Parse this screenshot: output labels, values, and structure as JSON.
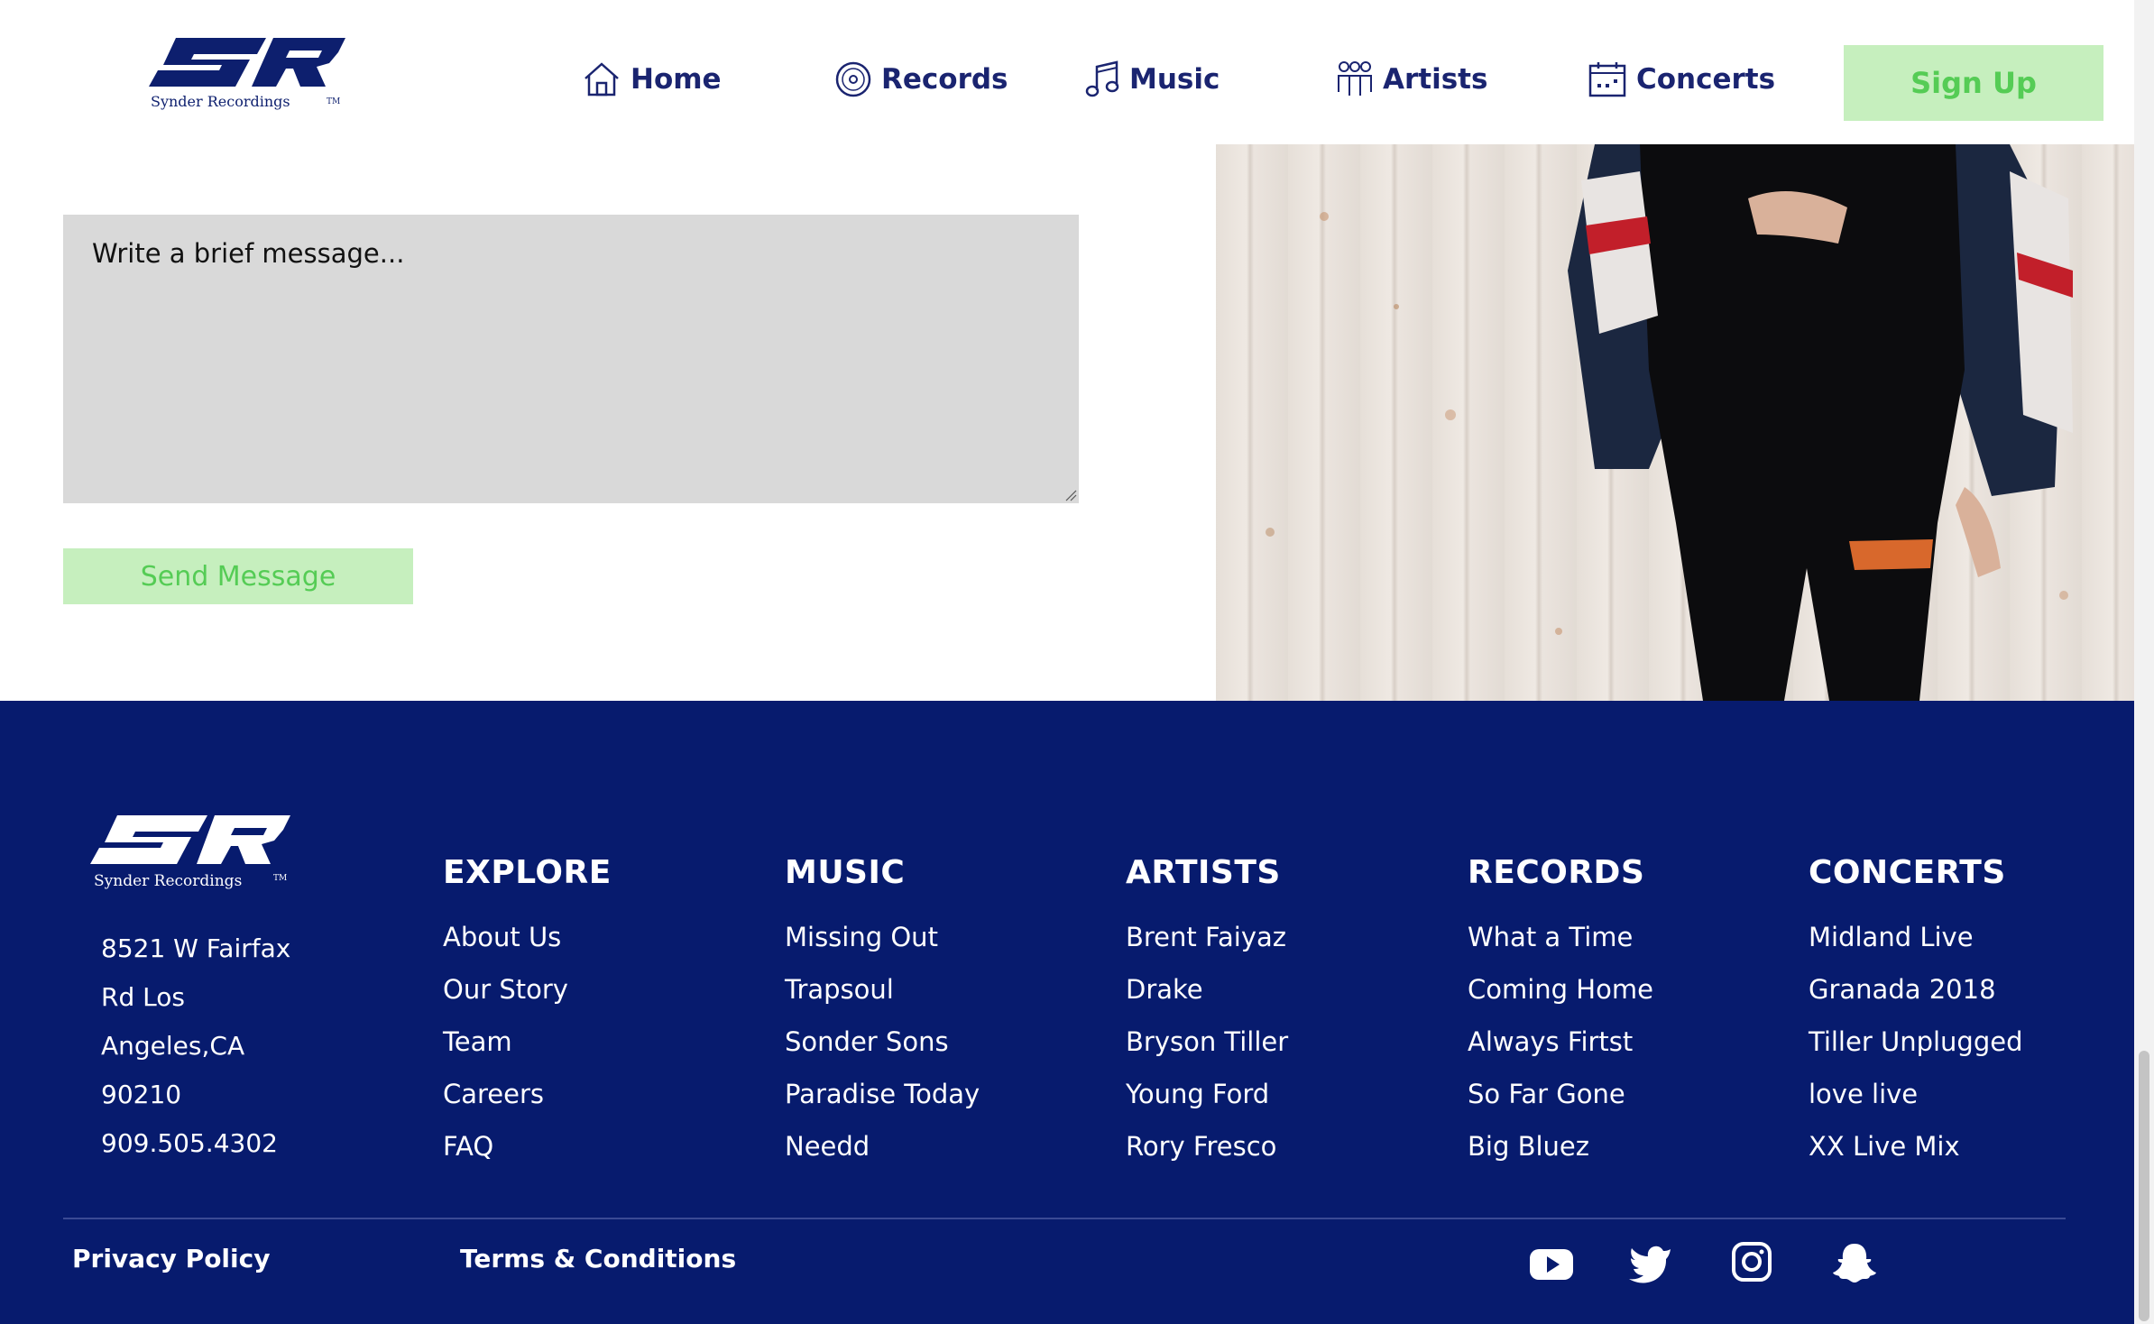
{
  "brand": {
    "logo_text": "SR",
    "tagline": "Synder   Recordings",
    "footer_tagline": "Synder Recordings",
    "tm": "TM"
  },
  "nav": {
    "items": [
      {
        "label": "Home",
        "icon": "home-icon"
      },
      {
        "label": "Records",
        "icon": "record-disc-icon"
      },
      {
        "label": "Music",
        "icon": "music-note-icon"
      },
      {
        "label": "Artists",
        "icon": "people-icon"
      },
      {
        "label": "Concerts",
        "icon": "calendar-icon"
      }
    ],
    "signup_label": "Sign Up"
  },
  "form": {
    "message_placeholder": "Write a brief message...",
    "send_label": "Send Message"
  },
  "footer": {
    "address": [
      "8521 W Fairfax",
      "Rd Los",
      "Angeles,CA",
      "90210",
      "909.505.4302"
    ],
    "columns": [
      {
        "heading": "EXPLORE",
        "links": [
          "About Us",
          "Our Story",
          "Team",
          "Careers",
          "FAQ"
        ]
      },
      {
        "heading": "MUSIC",
        "links": [
          "Missing Out",
          "Trapsoul",
          "Sonder Sons",
          "Paradise Today",
          "Needd"
        ]
      },
      {
        "heading": "ARTISTS",
        "links": [
          "Brent Faiyaz",
          "Drake",
          "Bryson Tiller",
          "Young Ford",
          "Rory Fresco"
        ]
      },
      {
        "heading": "RECORDS",
        "links": [
          "What a Time",
          "Coming Home",
          "Always Firtst",
          "So Far Gone",
          "Big Bluez"
        ]
      },
      {
        "heading": "CONCERTS",
        "links": [
          "Midland Live",
          "Granada 2018",
          "Tiller Unplugged",
          "love live",
          "XX Live Mix"
        ]
      }
    ],
    "privacy_label": "Privacy Policy",
    "terms_label": "Terms & Conditions",
    "social": [
      "youtube-icon",
      "twitter-icon",
      "instagram-icon",
      "snapchat-icon"
    ]
  },
  "colors": {
    "navy": "#071b6e",
    "nav_text": "#1a2470",
    "button_bg": "#c6efbe",
    "button_text": "#55cc55",
    "textarea_bg": "#d9d9d9"
  }
}
